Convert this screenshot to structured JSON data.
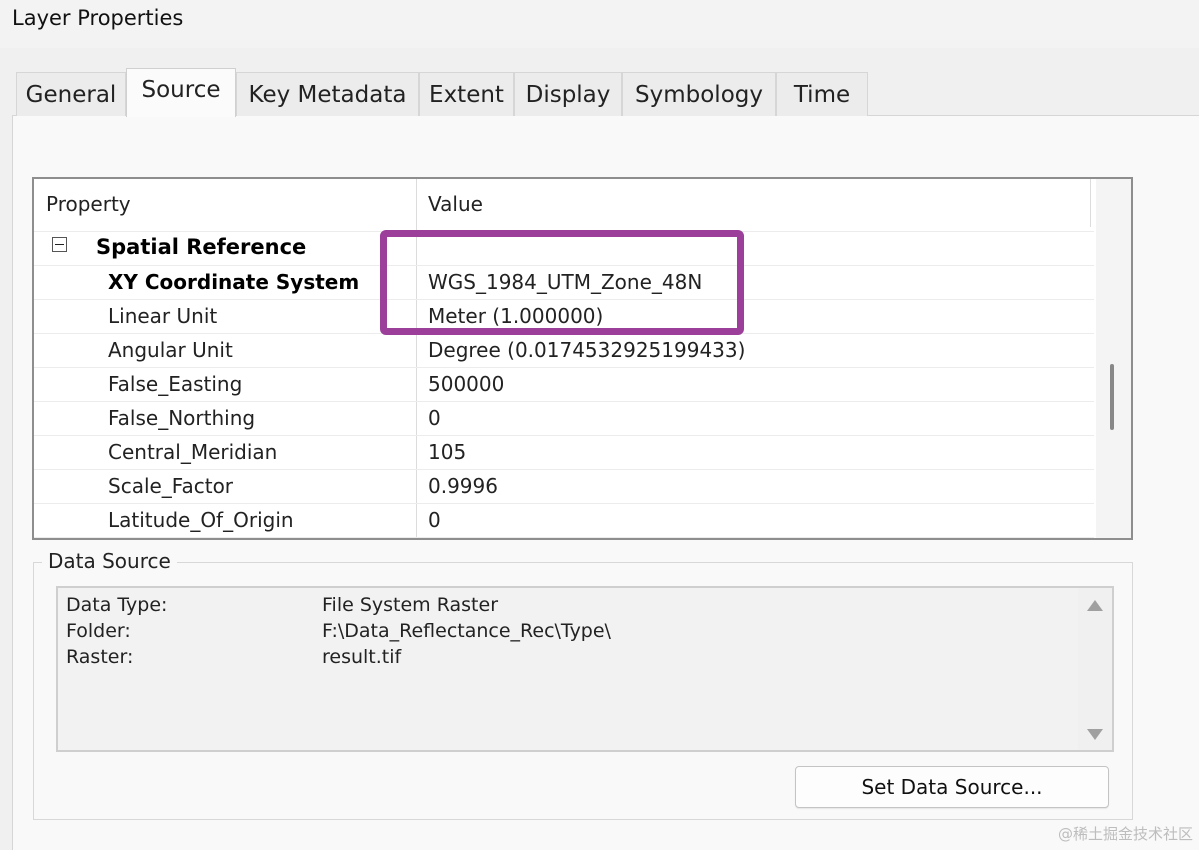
{
  "window": {
    "title": "Layer Properties"
  },
  "tabs": [
    {
      "label": "General",
      "active": false
    },
    {
      "label": "Source",
      "active": true
    },
    {
      "label": "Key Metadata",
      "active": false
    },
    {
      "label": "Extent",
      "active": false
    },
    {
      "label": "Display",
      "active": false
    },
    {
      "label": "Symbology",
      "active": false
    },
    {
      "label": "Time",
      "active": false
    }
  ],
  "property_grid": {
    "headers": {
      "property": "Property",
      "value": "Value"
    },
    "group": {
      "label": "Spatial Reference",
      "expanded": true
    },
    "rows": [
      {
        "property": "XY Coordinate System",
        "value": "WGS_1984_UTM_Zone_48N",
        "bold": true
      },
      {
        "property": "Linear Unit",
        "value": "Meter (1.000000)"
      },
      {
        "property": "Angular Unit",
        "value": "Degree (0.0174532925199433)"
      },
      {
        "property": "False_Easting",
        "value": "500000"
      },
      {
        "property": "False_Northing",
        "value": "0"
      },
      {
        "property": "Central_Meridian",
        "value": "105"
      },
      {
        "property": "Scale_Factor",
        "value": "0.9996"
      },
      {
        "property": "Latitude_Of_Origin",
        "value": "0"
      }
    ],
    "highlight_color": "#9b3f9b"
  },
  "data_source": {
    "legend": "Data Source",
    "rows": [
      {
        "key": "Data Type:",
        "value": "File System Raster"
      },
      {
        "key": "Folder:",
        "value": "F:\\Data_Reflectance_Rec\\Type\\"
      },
      {
        "key": "Raster:",
        "value": "result.tif"
      }
    ],
    "set_button_label": "Set Data Source..."
  },
  "watermark": "@稀土掘金技术社区"
}
